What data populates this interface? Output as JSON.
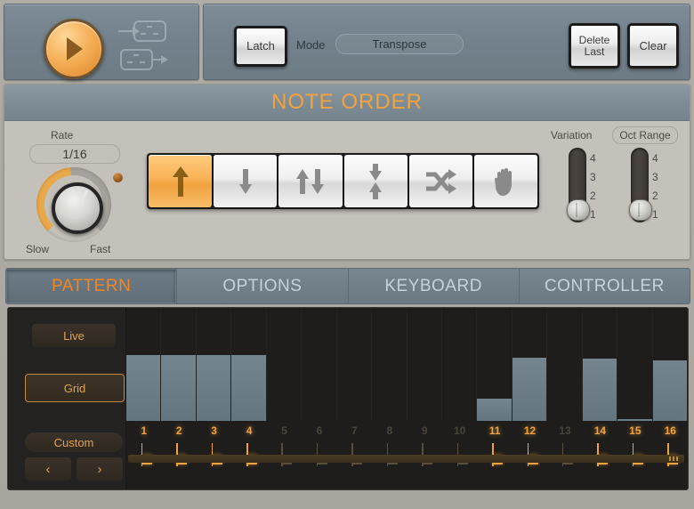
{
  "transport": {
    "play_button": "play-button",
    "midi_in_icon": "midi-in-icon",
    "midi_out_icon": "midi-out-icon"
  },
  "controls": {
    "latch_label": "Latch",
    "mode_label": "Mode",
    "mode_value": "Transpose",
    "delete_last_line1": "Delete",
    "delete_last_line2": "Last",
    "clear_label": "Clear"
  },
  "note_order": {
    "title": "NOTE ORDER",
    "rate_label": "Rate",
    "rate_value": "1/16",
    "knob_min_label": "Slow",
    "knob_max_label": "Fast",
    "buttons": [
      {
        "name": "order-up",
        "icon": "arrow-up-icon",
        "active": true
      },
      {
        "name": "order-down",
        "icon": "arrow-down-icon",
        "active": false
      },
      {
        "name": "order-up-down",
        "icon": "arrow-up-down-icon",
        "active": false
      },
      {
        "name": "order-down-up",
        "icon": "arrow-converge-icon",
        "active": false
      },
      {
        "name": "order-random",
        "icon": "shuffle-icon",
        "active": false
      },
      {
        "name": "order-as-played",
        "icon": "hand-icon",
        "active": false
      }
    ],
    "variation": {
      "label": "Variation",
      "ticks": [
        "4",
        "3",
        "2",
        "1"
      ],
      "value": 1
    },
    "oct_range": {
      "label": "Oct Range",
      "ticks": [
        "4",
        "3",
        "2",
        "1"
      ],
      "value": 1
    }
  },
  "tabs": [
    {
      "label": "PATTERN",
      "active": true
    },
    {
      "label": "OPTIONS",
      "active": false
    },
    {
      "label": "KEYBOARD",
      "active": false
    },
    {
      "label": "CONTROLLER",
      "active": false
    }
  ],
  "pattern": {
    "live_label": "Live",
    "grid_label": "Grid",
    "custom_label": "Custom",
    "prev_label": "‹",
    "next_label": "›",
    "steps": [
      {
        "number": "1",
        "active": true,
        "height": 74
      },
      {
        "number": "2",
        "active": true,
        "height": 74
      },
      {
        "number": "3",
        "active": true,
        "height": 74
      },
      {
        "number": "4",
        "active": true,
        "height": 74
      },
      {
        "number": "5",
        "active": false,
        "height": 0
      },
      {
        "number": "6",
        "active": false,
        "height": 0
      },
      {
        "number": "7",
        "active": false,
        "height": 0
      },
      {
        "number": "8",
        "active": false,
        "height": 0
      },
      {
        "number": "9",
        "active": false,
        "height": 0
      },
      {
        "number": "10",
        "active": false,
        "height": 0
      },
      {
        "number": "11",
        "active": true,
        "height": 25
      },
      {
        "number": "12",
        "active": true,
        "height": 71
      },
      {
        "number": "13",
        "active": false,
        "height": 0
      },
      {
        "number": "14",
        "active": true,
        "height": 70
      },
      {
        "number": "15",
        "active": true,
        "height": 2
      },
      {
        "number": "16",
        "active": true,
        "height": 68
      }
    ]
  },
  "colors": {
    "accent_orange": "#f4a33c",
    "tab_active_text": "#f4861f",
    "panel_bg": "#c4c1ba",
    "header_blue": "#7e8c96",
    "bar_blue": "#6c7d87",
    "pattern_bg": "#1e1d1b"
  }
}
